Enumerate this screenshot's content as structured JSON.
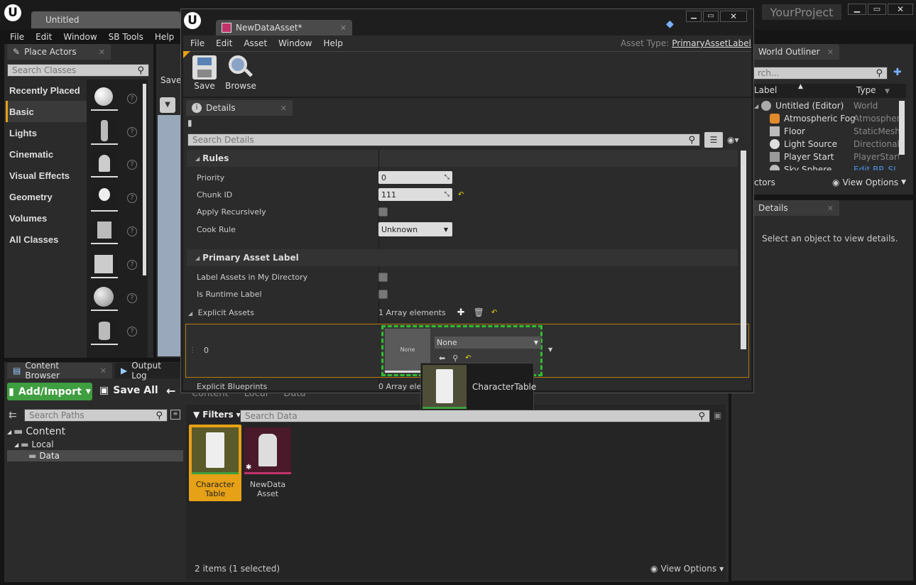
{
  "main_window": {
    "tab_title": "Untitled",
    "project_name": "YourProject",
    "menu": [
      "File",
      "Edit",
      "Window",
      "SB Tools",
      "Help"
    ]
  },
  "place_actors": {
    "tab_label": "Place Actors",
    "search_placeholder": "Search Classes",
    "categories": [
      "Recently Placed",
      "Basic",
      "Lights",
      "Cinematic",
      "Visual Effects",
      "Geometry",
      "Volumes",
      "All Classes"
    ],
    "selected": "Basic"
  },
  "toolbar_partial": {
    "save_label": "Save"
  },
  "world_outliner": {
    "tab_label": "World Outliner",
    "search_placeholder": "rch...",
    "col_label": "Label",
    "col_type": "Type",
    "items": [
      {
        "label": "Untitled (Editor)",
        "type": "World"
      },
      {
        "label": "Atmospheric Fog",
        "type": "Atmospher"
      },
      {
        "label": "Floor",
        "type": "StaticMesh"
      },
      {
        "label": "Light Source",
        "type": "Directional"
      },
      {
        "label": "Player Start",
        "type": "PlayerStart"
      },
      {
        "label": "Sky Sphere",
        "type": "Edit BP_SI"
      }
    ],
    "actors_count": "ctors",
    "view_options": "View Options"
  },
  "right_details": {
    "tab_label": "Details",
    "empty_text": "Select an object to view details."
  },
  "content_browser": {
    "tab_label": "Content Browser",
    "output_log_tab": "Output Log",
    "add_import": "Add/Import",
    "save_all": "Save All",
    "search_paths_placeholder": "Search Paths",
    "tree": [
      "Content",
      "Local",
      "Data"
    ],
    "filters_label": "Filters",
    "search_data_placeholder": "Search Data",
    "assets": [
      {
        "name1": "Character",
        "name2": "Table",
        "selected": true
      },
      {
        "name1": "NewData",
        "name2": "Asset",
        "selected": false
      }
    ],
    "status": "2 items (1 selected)",
    "view_options": "View Options",
    "breadcrumb": [
      "Content",
      "Local",
      "Data"
    ]
  },
  "asset_editor": {
    "tab_title": "NewDataAsset*",
    "menu": [
      "File",
      "Edit",
      "Asset",
      "Window",
      "Help"
    ],
    "asset_type_label": "Asset Type:",
    "asset_type_value": "PrimaryAssetLabel",
    "toolbar": {
      "save": "Save",
      "browse": "Browse"
    },
    "details_tab": "Details",
    "search_placeholder": "Search Details",
    "sections": {
      "rules": "Rules",
      "primary": "Primary Asset Label"
    },
    "props": {
      "priority_label": "Priority",
      "priority_value": "0",
      "chunk_label": "Chunk ID",
      "chunk_value": "111",
      "recursive_label": "Apply Recursively",
      "cook_label": "Cook Rule",
      "cook_value": "Unknown",
      "my_dir_label": "Label Assets in My Directory",
      "runtime_label": "Is Runtime Label",
      "explicit_assets_label": "Explicit Assets",
      "explicit_assets_value": "1 Array elements",
      "index": "0",
      "thumb_none": "None",
      "combo_value": "None",
      "explicit_bp_label": "Explicit Blueprints",
      "explicit_bp_value": "0 Array ele"
    },
    "drag_tooltip": "CharacterTable"
  },
  "colors": {
    "accent": "#e6a116",
    "add_green": "#3f9e3f",
    "drop_green": "#2fbf2f",
    "asset_pink": "#c0336a"
  }
}
